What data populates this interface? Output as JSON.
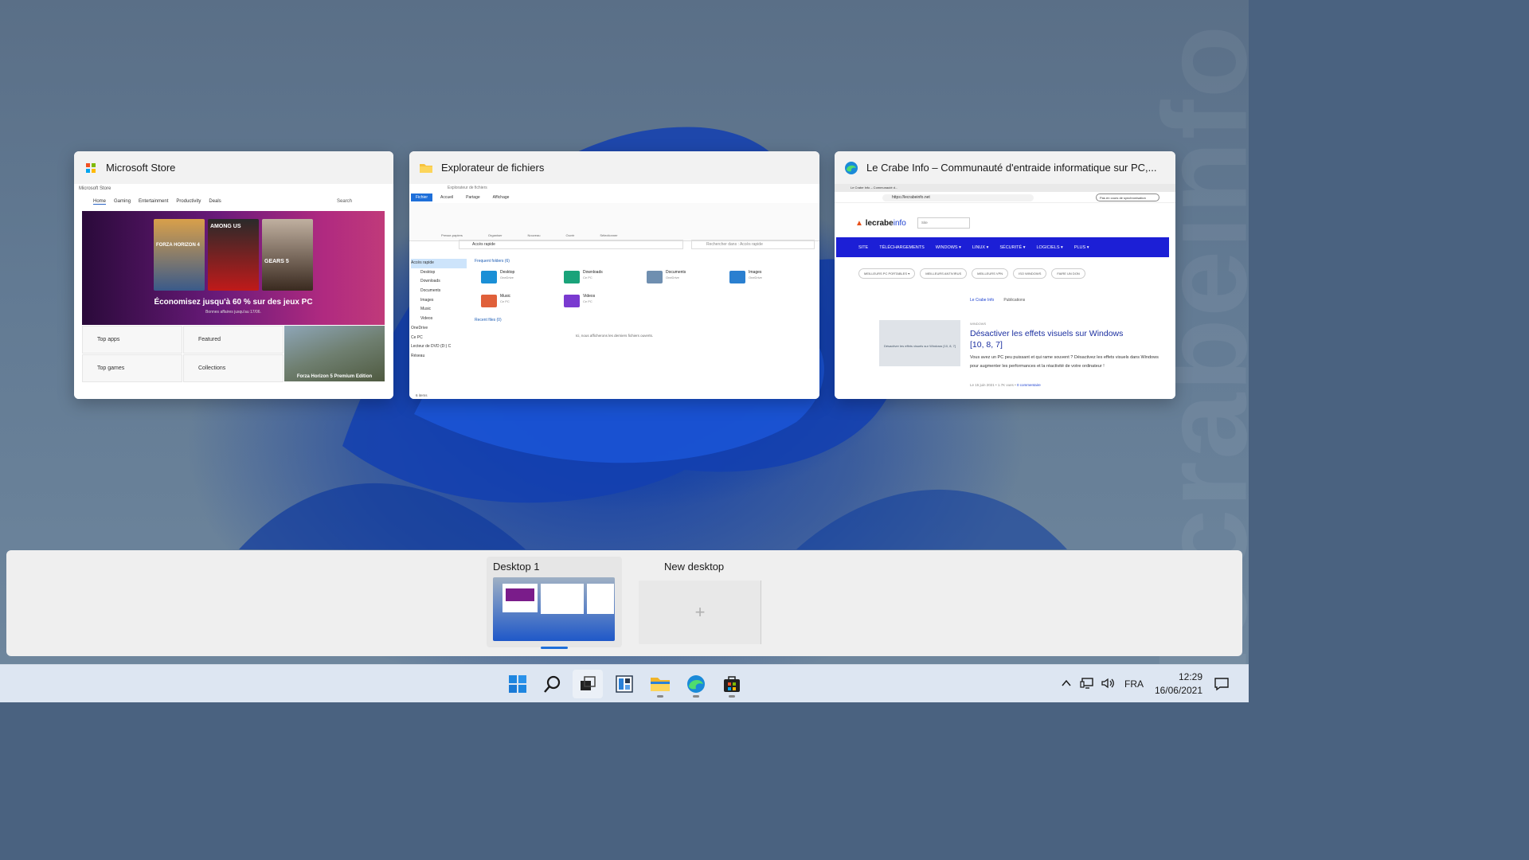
{
  "windows": {
    "store": {
      "title": "Microsoft Store",
      "titlebar": "Microsoft Store",
      "nav": [
        "Home",
        "Gaming",
        "Entertainment",
        "Productivity",
        "Deals"
      ],
      "search": "Search",
      "games": [
        "FORZA HORIZON 4",
        "AMONG US",
        "GEARS 5"
      ],
      "promo": "Économisez jusqu'à 60 % sur des jeux PC",
      "promo_sub": "Bonnes affaires jusqu'au 17/06.",
      "tiles": [
        "Top apps",
        "Featured",
        "Top games",
        "Collections"
      ],
      "featured_caption": "Forza Horizon 5 Premium Edition"
    },
    "explorer": {
      "title": "Explorateur de fichiers",
      "titlebar": "Explorateur de fichiers",
      "tabs": [
        "Fichier",
        "Accueil",
        "Partage",
        "Affichage"
      ],
      "ribbon_groups": [
        "Presse-papiers",
        "Organiser",
        "Nouveau",
        "Ouvrir",
        "Sélectionner"
      ],
      "address": "Accès rapide",
      "search_placeholder": "Rechercher dans : Accès rapide",
      "tree": [
        "Accès rapide",
        "Desktop",
        "Downloads",
        "Documents",
        "Images",
        "Music",
        "Videos",
        "OneDrive",
        "Ce PC",
        "Lecteur de DVD (D:) C",
        "Réseau"
      ],
      "frequent_header": "Frequent folders (6)",
      "folders": [
        {
          "name": "Desktop",
          "sub": "OneDrive",
          "color": "#1a8fd6"
        },
        {
          "name": "Downloads",
          "sub": "Ce PC",
          "color": "#1aa37a"
        },
        {
          "name": "Documents",
          "sub": "OneDrive",
          "color": "#6f8fb0"
        },
        {
          "name": "Images",
          "sub": "OneDrive",
          "color": "#2a7fd0"
        },
        {
          "name": "Music",
          "sub": "Ce PC",
          "color": "#e0603a"
        },
        {
          "name": "Videos",
          "sub": "Ce PC",
          "color": "#7a3ad0"
        }
      ],
      "recent_header": "Recent files (0)",
      "recent_empty": "Ici, nous afficherons les derniers fichiers ouverts.",
      "status": "6 items"
    },
    "edge": {
      "title": "Le Crabe Info – Communauté d'entraide informatique sur PC,...",
      "tab": "Le Crabe Info – Communauté d...",
      "url": "https://lecrabeinfo.net",
      "sync": "Pas en cours de synchronisation",
      "logo_a": "lecrabe",
      "logo_b": "info",
      "site_select": "Site",
      "nav": [
        "SITE",
        "TÉLÉCHARGEMENTS",
        "WINDOWS ▾",
        "LINUX ▾",
        "SÉCURITÉ ▾",
        "LOGICIELS ▾",
        "PLUS ▾"
      ],
      "pills": [
        "MEILLEURS PC PORTABLES ▾",
        "MEILLEURS ANTIVIRUS",
        "MEILLEURS VPN",
        "ISO WINDOWS",
        "FAIRE UN DON"
      ],
      "breadcrumb_a": "Le Crabe Info",
      "breadcrumb_b": "Publications",
      "thumb_caption": "Désactiver les effets visuels sur Windows [10, 8, 7]",
      "kicker": "WINDOWS",
      "article_title": "Désactiver les effets visuels sur Windows [10, 8, 7]",
      "article_desc": "Vous avez un PC peu puissant et qui rame souvent ? Désactivez les effets visuels dans Windows pour augmenter les performances et la réactivité de votre ordinateur !",
      "meta": "Le 15 juin 2021 • 1.7K vues •",
      "comments": "0 commentaire"
    }
  },
  "desktops": {
    "desk1": "Desktop 1",
    "new": "New desktop",
    "new_symbol": "+"
  },
  "taskbar": {
    "language": "FRA",
    "time": "12:29",
    "date": "16/06/2021",
    "icons": [
      "start-icon",
      "search-icon",
      "task-view-icon",
      "widgets-icon",
      "file-explorer-icon",
      "edge-icon",
      "store-icon"
    ]
  },
  "colors": {
    "accent": "#1e6fd9",
    "lecrabe_nav": "#1c1fd6"
  }
}
